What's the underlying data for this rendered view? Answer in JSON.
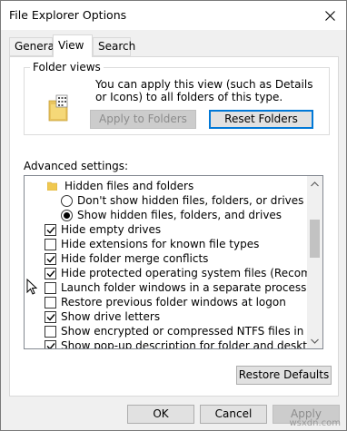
{
  "window": {
    "title": "File Explorer Options"
  },
  "tabs": [
    {
      "label": "General"
    },
    {
      "label": "View"
    },
    {
      "label": "Search"
    }
  ],
  "folder_views": {
    "legend": "Folder views",
    "description": "You can apply this view (such as Details or Icons) to all folders of this type.",
    "apply_label": "Apply to Folders",
    "reset_label": "Reset Folders"
  },
  "advanced": {
    "label": "Advanced settings:",
    "items": [
      {
        "type": "folder",
        "label": "Hidden files and folders"
      },
      {
        "type": "radio",
        "checked": false,
        "label": "Don't show hidden files, folders, or drives"
      },
      {
        "type": "radio",
        "checked": true,
        "label": "Show hidden files, folders, and drives"
      },
      {
        "type": "checkbox",
        "checked": true,
        "label": "Hide empty drives"
      },
      {
        "type": "checkbox",
        "checked": false,
        "label": "Hide extensions for known file types"
      },
      {
        "type": "checkbox",
        "checked": true,
        "label": "Hide folder merge conflicts"
      },
      {
        "type": "checkbox",
        "checked": true,
        "label": "Hide protected operating system files (Recommended)"
      },
      {
        "type": "checkbox",
        "checked": false,
        "label": "Launch folder windows in a separate process"
      },
      {
        "type": "checkbox",
        "checked": false,
        "label": "Restore previous folder windows at logon"
      },
      {
        "type": "checkbox",
        "checked": true,
        "label": "Show drive letters"
      },
      {
        "type": "checkbox",
        "checked": false,
        "label": "Show encrypted or compressed NTFS files in color"
      },
      {
        "type": "checkbox",
        "checked": true,
        "label": "Show pop-up description for folder and desktop items"
      }
    ]
  },
  "restore_defaults_label": "Restore Defaults",
  "footer": {
    "ok_label": "OK",
    "cancel_label": "Cancel",
    "apply_label": "Apply"
  },
  "watermark": "wsxdn.com"
}
